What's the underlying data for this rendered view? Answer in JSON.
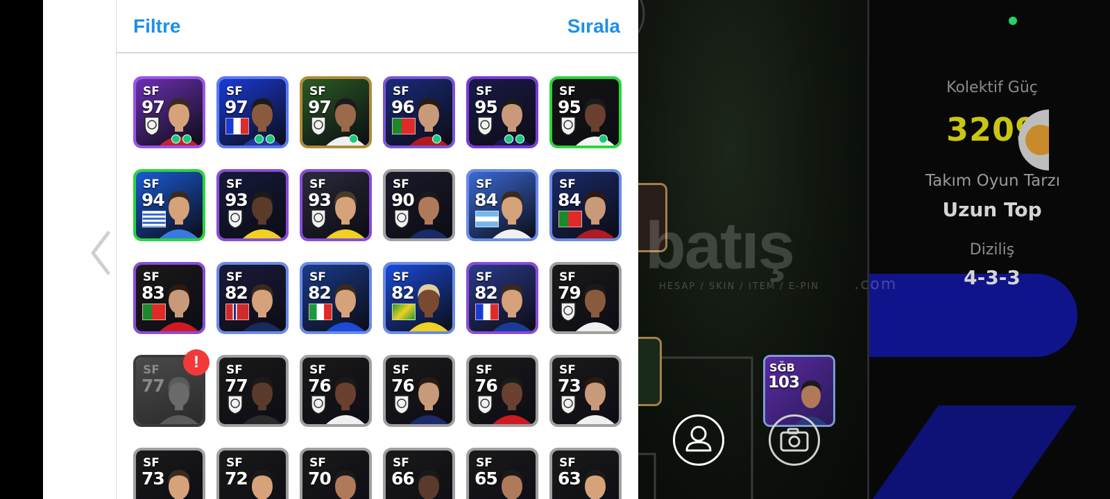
{
  "panel": {
    "filter_label": "Filtre",
    "sort_label": "Sırala"
  },
  "players": [
    {
      "pos": "SF",
      "rating": "97",
      "bg": "#6b2fb0",
      "border": "#9a55e6",
      "flag": "club-crest",
      "skin": "#d6a27a",
      "hair": "#3a2a1e",
      "shirt": "#c22233"
    },
    {
      "pos": "SF",
      "rating": "97",
      "bg": "#1a3ad6",
      "border": "#5a7af0",
      "flag": "france",
      "skin": "#8a5a3c",
      "hair": "#1a1a1a",
      "shirt": "#233a9a"
    },
    {
      "pos": "SF",
      "rating": "97",
      "bg": "#2a5a22",
      "border": "#b08a3a",
      "flag": "club-crest",
      "skin": "#9a6a4a",
      "hair": "#1a1a1a",
      "shirt": "#f0f0f0"
    },
    {
      "pos": "SF",
      "rating": "96",
      "bg": "#1a2a7a",
      "border": "#7a55d6",
      "flag": "portugal",
      "skin": "#c99a7a",
      "hair": "#2a1a10",
      "shirt": "#b01a22"
    },
    {
      "pos": "SF",
      "rating": "95",
      "bg": "#1a1a4a",
      "border": "#7a3ad6",
      "flag": "club-crest",
      "skin": "#c99a7a",
      "hair": "#1a1a1a",
      "shirt": "#1a1a5a"
    },
    {
      "pos": "SF",
      "rating": "95",
      "bg": "#141414",
      "border": "#2ad63a",
      "flag": "club-crest",
      "skin": "#6a4030",
      "hair": "#1a1a1a",
      "shirt": "#f4f4f4"
    },
    {
      "pos": "SF",
      "rating": "94",
      "bg": "#1a5ad6",
      "border": "#2ad63a",
      "flag": "uruguay",
      "skin": "#d6a27a",
      "hair": "#3a2a1e",
      "shirt": "#3a7ae0"
    },
    {
      "pos": "SF",
      "rating": "93",
      "bg": "#141a3a",
      "border": "#8a4bd6",
      "flag": "club-crest",
      "skin": "#5a3a2a",
      "hair": "#1a1a1a",
      "shirt": "#f0d020"
    },
    {
      "pos": "SF",
      "rating": "93",
      "bg": "#2a2a3a",
      "border": "#8a4bd6",
      "flag": "club-crest",
      "skin": "#d6a27a",
      "hair": "#4a3a2a",
      "shirt": "#f0d020"
    },
    {
      "pos": "SF",
      "rating": "90",
      "bg": "#1a1a2a",
      "border": "#a0a0a0",
      "flag": "club-crest",
      "skin": "#b07a5a",
      "hair": "#1a1a1a",
      "shirt": "#1a2a6a"
    },
    {
      "pos": "SF",
      "rating": "84",
      "bg": "#3a6ad6",
      "border": "#6a8ae6",
      "flag": "argentina",
      "skin": "#d6a27a",
      "hair": "#3a2a1e",
      "shirt": "#f0f0f0"
    },
    {
      "pos": "SF",
      "rating": "84",
      "bg": "#1a2a6a",
      "border": "#6a8ae6",
      "flag": "portugal",
      "skin": "#c99a7a",
      "hair": "#2a1a10",
      "shirt": "#b01a22"
    },
    {
      "pos": "SF",
      "rating": "83",
      "bg": "#1a1a1a",
      "border": "#8a4bd6",
      "flag": "portugal",
      "skin": "#c99a7a",
      "hair": "#2a1a10",
      "shirt": "#d01a22"
    },
    {
      "pos": "SF",
      "rating": "82",
      "bg": "#1a1a3a",
      "border": "#6a8ae6",
      "flag": "norway",
      "skin": "#d6a27a",
      "hair": "#3a2a1e",
      "shirt": "#1a2a5a"
    },
    {
      "pos": "SF",
      "rating": "82",
      "bg": "#1a3a8a",
      "border": "#6a8ae6",
      "flag": "italy",
      "skin": "#d6a27a",
      "hair": "#3a2a1e",
      "shirt": "#1a4ad6"
    },
    {
      "pos": "SF",
      "rating": "82",
      "bg": "#1a4ad6",
      "border": "#6a8ae6",
      "flag": "brazil",
      "skin": "#7a4a30",
      "hair": "#e0d0a0",
      "shirt": "#f0d020"
    },
    {
      "pos": "SF",
      "rating": "82",
      "bg": "#2a3a8a",
      "border": "#8a4bd6",
      "flag": "france",
      "skin": "#d6a27a",
      "hair": "#3a2a1e",
      "shirt": "#1a3a9a"
    },
    {
      "pos": "SF",
      "rating": "79",
      "bg": "#1a1a1a",
      "border": "#a0a0a0",
      "flag": "club-crest",
      "skin": "#8a5a3c",
      "hair": "#1a1a1a",
      "shirt": "#f0f0f0"
    },
    {
      "pos": "SF",
      "rating": "77",
      "bg": "#3a3a3a",
      "border": "#3a3a3a",
      "flag": "none",
      "skin": "#6a6a6a",
      "hair": "#5a5a5a",
      "shirt": "#5a5a5a",
      "gray": true,
      "alert": "!"
    },
    {
      "pos": "SF",
      "rating": "77",
      "bg": "#1a1a1a",
      "border": "#a0a0a0",
      "flag": "club-crest",
      "skin": "#5a3a2a",
      "hair": "#1a1a1a",
      "shirt": "#2a2a2a"
    },
    {
      "pos": "SF",
      "rating": "76",
      "bg": "#1a1a1a",
      "border": "#a0a0a0",
      "flag": "club-crest",
      "skin": "#6a4030",
      "hair": "#1a1a1a",
      "shirt": "#f0f0f0"
    },
    {
      "pos": "SF",
      "rating": "76",
      "bg": "#1a1a1a",
      "border": "#a0a0a0",
      "flag": "club-crest",
      "skin": "#c99a7a",
      "hair": "#2a1a10",
      "shirt": "#1a2a6a"
    },
    {
      "pos": "SF",
      "rating": "76",
      "bg": "#1a1a1a",
      "border": "#a0a0a0",
      "flag": "club-crest",
      "skin": "#6a4030",
      "hair": "#1a1a1a",
      "shirt": "#d01a22"
    },
    {
      "pos": "SF",
      "rating": "73",
      "bg": "#1a1a1a",
      "border": "#a0a0a0",
      "flag": "club-crest",
      "skin": "#c99a7a",
      "hair": "#2a1a10",
      "shirt": "#f0f0f0"
    },
    {
      "pos": "SF",
      "rating": "73",
      "bg": "#1a1a1a",
      "border": "#a0a0a0",
      "flag": "none",
      "skin": "#d6a27a",
      "hair": "#3a2a1e",
      "shirt": "#f0f0f0"
    },
    {
      "pos": "SF",
      "rating": "72",
      "bg": "#1a1a1a",
      "border": "#a0a0a0",
      "flag": "none",
      "skin": "#d6a27a",
      "hair": "#1a1a1a",
      "shirt": "#2a2a2a"
    },
    {
      "pos": "SF",
      "rating": "70",
      "bg": "#1a1a1a",
      "border": "#a0a0a0",
      "flag": "none",
      "skin": "#b07a5a",
      "hair": "#1a1a1a",
      "shirt": "#d01a22"
    },
    {
      "pos": "SF",
      "rating": "66",
      "bg": "#1a1a1a",
      "border": "#a0a0a0",
      "flag": "none",
      "skin": "#5a3a2a",
      "hair": "#1a1a1a",
      "shirt": "#2a2a2a"
    },
    {
      "pos": "SF",
      "rating": "65",
      "bg": "#1a1a1a",
      "border": "#a0a0a0",
      "flag": "none",
      "skin": "#b07a5a",
      "hair": "#1a1a1a",
      "shirt": "#1a6a3a"
    },
    {
      "pos": "SF",
      "rating": "63",
      "bg": "#1a1a1a",
      "border": "#a0a0a0",
      "flag": "none",
      "skin": "#d6a27a",
      "hair": "#1a1a1a",
      "shirt": "#d01a22"
    }
  ],
  "team": {
    "collective_power_label": "Kolektif Güç",
    "collective_power_value": "3209",
    "play_style_label": "Takım Oyun Tarzı",
    "play_style_value": "Uzun Top",
    "formation_label": "Diziliş",
    "formation_value": "4-3-3"
  },
  "pitch_card": {
    "pos": "SĞB",
    "rating": "103"
  },
  "watermark": {
    "text": "batış",
    "sub": "HESAP / SKIN / ITEM / E-PIN",
    "domain": ".com"
  },
  "icons": [
    "chevron-left-icon",
    "user-icon",
    "camera-icon"
  ],
  "colors": {
    "accent": "#1e90e6",
    "power": "#c9c514",
    "alert": "#f03a3a"
  }
}
